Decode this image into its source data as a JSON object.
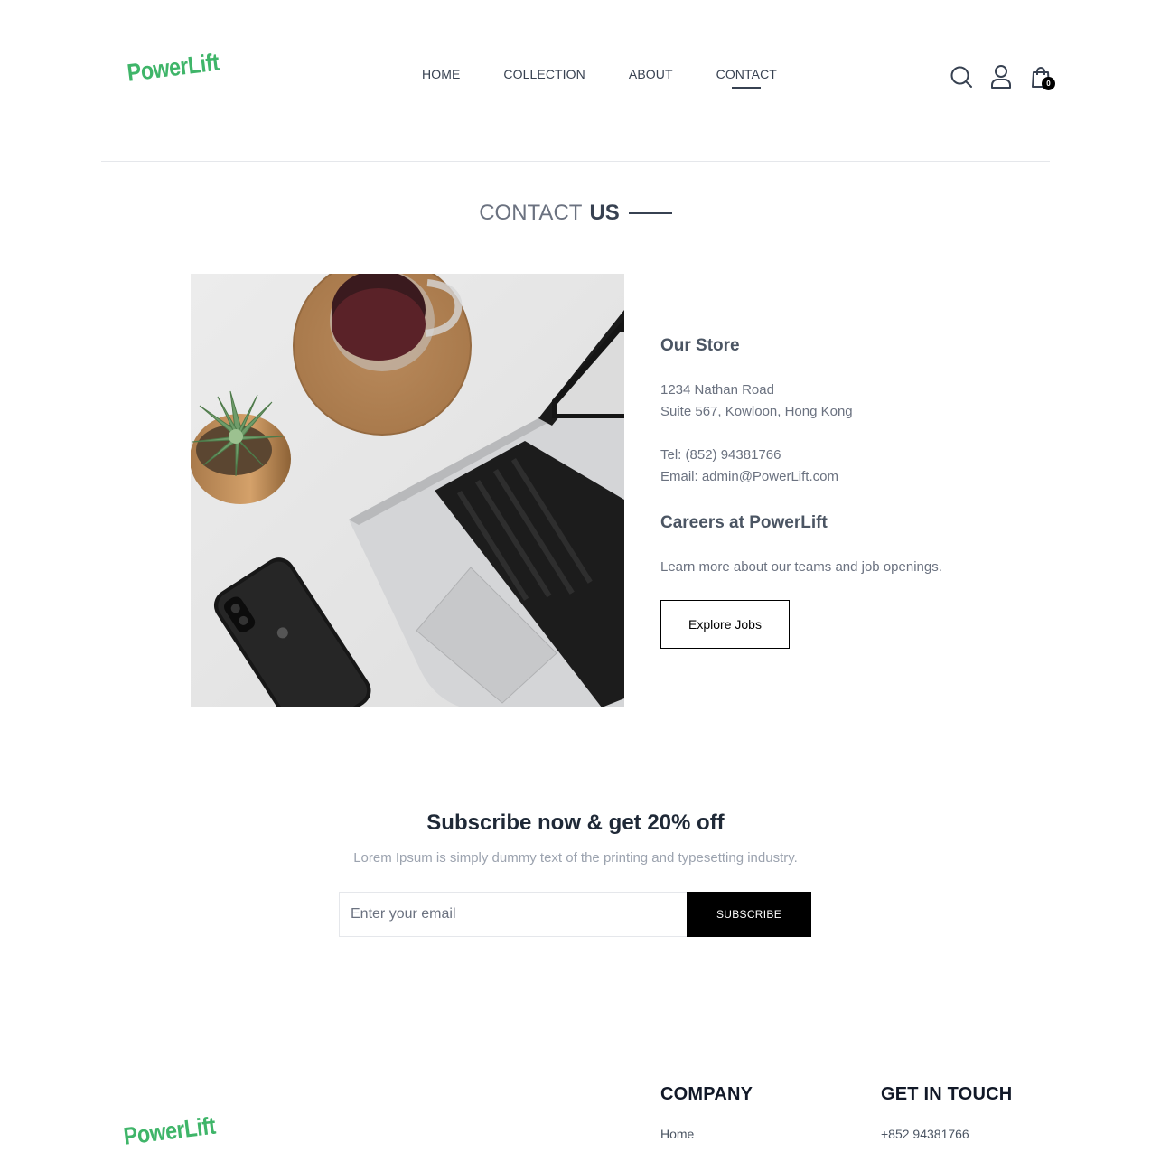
{
  "brand": {
    "name": "PowerLift",
    "color": "#3fb569"
  },
  "nav": {
    "items": [
      {
        "label": "HOME"
      },
      {
        "label": "COLLECTION"
      },
      {
        "label": "ABOUT"
      },
      {
        "label": "CONTACT",
        "active": true
      }
    ]
  },
  "header_icons": {
    "search": "search-icon",
    "profile": "user-icon",
    "cart": "cart-icon",
    "cart_count": "0"
  },
  "page_title": {
    "part1": "CONTACT",
    "part2": "US"
  },
  "store": {
    "title": "Our Store",
    "address_line1": "1234 Nathan Road",
    "address_line2": "Suite 567, Kowloon, Hong Kong",
    "tel": "Tel: (852) 94381766",
    "email": "Email: admin@PowerLift.com"
  },
  "careers": {
    "title": "Careers at PowerLift",
    "text": "Learn more about our teams and job openings.",
    "button_label": "Explore Jobs"
  },
  "subscribe": {
    "title": "Subscribe now & get 20% off",
    "subtitle": "Lorem Ipsum is simply dummy text of the printing and typesetting industry.",
    "placeholder": "Enter your email",
    "button_label": "SUBSCRIBE"
  },
  "footer": {
    "company": {
      "title": "COMPANY",
      "items": [
        "Home"
      ]
    },
    "get_in_touch": {
      "title": "GET IN TOUCH",
      "items": [
        "+852 94381766"
      ]
    }
  }
}
